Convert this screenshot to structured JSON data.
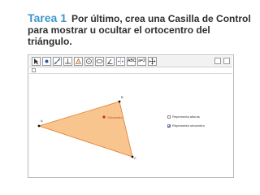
{
  "slide": {
    "tarea_label": "Tarea 1",
    "instruction": "Por último, crea una Casilla de Control para mostrar u ocultar el ortocentro del triángulo."
  },
  "toolbar": {
    "tools": [
      "move-tool-icon",
      "new-point-icon",
      "line-through-two-points-icon",
      "perpendicular-line-icon",
      "polygon-icon",
      "circle-icon",
      "ellipse-icon",
      "angle-icon",
      "reflect-icon",
      "text-tool-icon",
      "slider-icon",
      "move-view-icon"
    ],
    "text_tool_label": "ABC",
    "slider_label": "a=2"
  },
  "canvas": {
    "points": {
      "A": "A",
      "B": "B",
      "C": "C"
    },
    "orthocenter_label": "Ortocentro",
    "checkboxes": [
      {
        "label": "Representa alturas",
        "checked": false
      },
      {
        "label": "Representa ortocentro",
        "checked": true
      }
    ],
    "colors": {
      "triangle_fill": "#f9c58f",
      "triangle_stroke": "#e07a2c",
      "orthocenter": "#c62828",
      "accent_title": "#3f97c9"
    }
  }
}
